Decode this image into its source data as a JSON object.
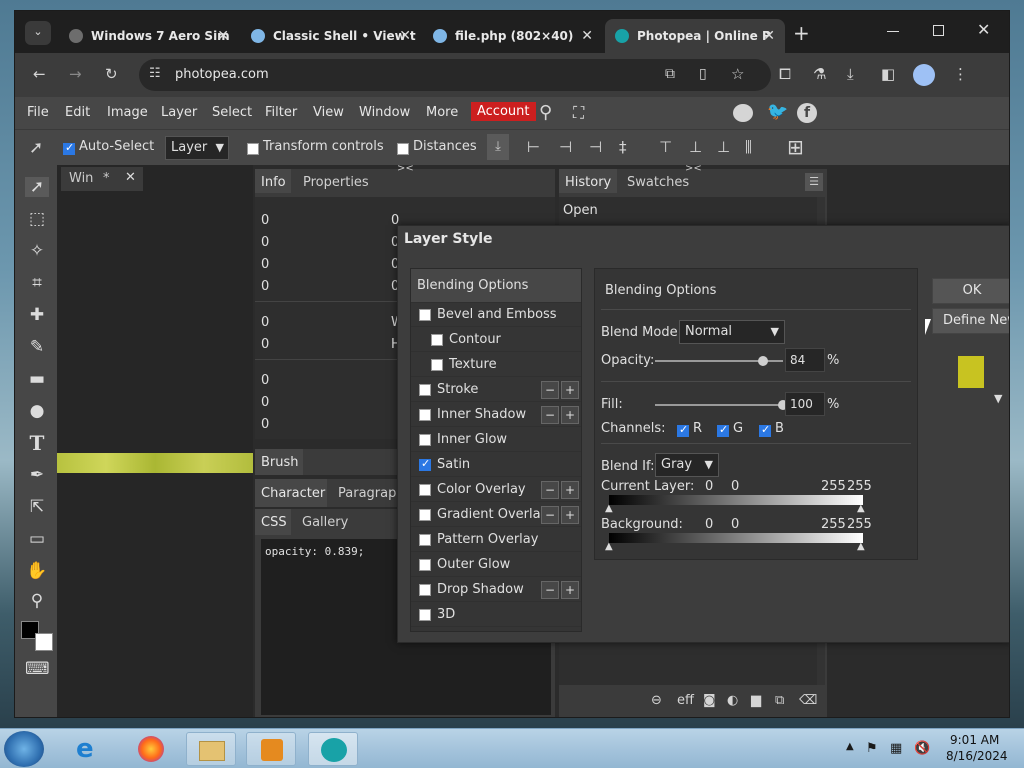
{
  "browser": {
    "tabs": [
      {
        "title": "Windows 7 Aero Sim",
        "color": "#6d6d6d"
      },
      {
        "title": "Classic Shell • View t",
        "color": "#7fb6e6"
      },
      {
        "title": "file.php (802×40)",
        "color": "#7fb6e6"
      },
      {
        "title": "Photopea | Online P",
        "color": "#18a2a7"
      }
    ],
    "new_tab": "+",
    "close": "✕",
    "address": "photopea.com"
  },
  "menu": {
    "items": [
      "File",
      "Edit",
      "Image",
      "Layer",
      "Select",
      "Filter",
      "View",
      "Window",
      "More"
    ],
    "account": "Account"
  },
  "toolbar": {
    "auto_select": "Auto-Select",
    "layer_select": "Layer",
    "transform_controls": "Transform controls",
    "distances": "Distances"
  },
  "doc_tab": {
    "name": "Win",
    "marker": "*",
    "close": "✕"
  },
  "info_panel": {
    "tabs": [
      "Info",
      "Properties"
    ],
    "rows_left": [
      "0",
      "0",
      "0",
      "0",
      "0",
      "0",
      "0",
      "0",
      "0"
    ],
    "rows_right": [
      "0",
      "0",
      "0",
      "0",
      "W",
      "H"
    ]
  },
  "history_panel": {
    "tabs": [
      "History",
      "Swatches"
    ],
    "items": [
      "Open"
    ]
  },
  "brush_panel": {
    "label": "Brush"
  },
  "char_panel": {
    "tabs": [
      "Character",
      "Paragraph"
    ]
  },
  "css_panel": {
    "tabs": [
      "CSS",
      "Gallery"
    ],
    "code": "opacity: 0.839;"
  },
  "dialog": {
    "title": "Layer Style",
    "left_header": "Blending Options",
    "styles": [
      {
        "label": "Bevel and Emboss",
        "checked": false,
        "indent": false,
        "buttons": false
      },
      {
        "label": "Contour",
        "checked": false,
        "indent": true,
        "buttons": false
      },
      {
        "label": "Texture",
        "checked": false,
        "indent": true,
        "buttons": false
      },
      {
        "label": "Stroke",
        "checked": false,
        "indent": false,
        "buttons": true
      },
      {
        "label": "Inner Shadow",
        "checked": false,
        "indent": false,
        "buttons": true
      },
      {
        "label": "Inner Glow",
        "checked": false,
        "indent": false,
        "buttons": false
      },
      {
        "label": "Satin",
        "checked": true,
        "indent": false,
        "buttons": false
      },
      {
        "label": "Color Overlay",
        "checked": false,
        "indent": false,
        "buttons": true
      },
      {
        "label": "Gradient Overlay",
        "checked": false,
        "indent": false,
        "buttons": true
      },
      {
        "label": "Pattern Overlay",
        "checked": false,
        "indent": false,
        "buttons": false
      },
      {
        "label": "Outer Glow",
        "checked": false,
        "indent": false,
        "buttons": false
      },
      {
        "label": "Drop Shadow",
        "checked": false,
        "indent": false,
        "buttons": true
      },
      {
        "label": "3D",
        "checked": false,
        "indent": false,
        "buttons": false
      }
    ],
    "minus": "−",
    "plus": "+",
    "right_header": "Blending Options",
    "blend_mode_label": "Blend Mode:",
    "blend_mode": "Normal",
    "opacity_label": "Opacity:",
    "opacity": "84",
    "opacity_level": 0.84,
    "percent": "%",
    "fill_label": "Fill:",
    "fill": "100",
    "fill_level": 1.0,
    "channels_label": "Channels:",
    "channels": [
      "R",
      "G",
      "B"
    ],
    "blend_if_label": "Blend If:",
    "blend_if": "Gray",
    "current_layer_label": "Current Layer:",
    "current_layer_values": [
      "0",
      "0",
      "255",
      "255"
    ],
    "background_label": "Background:",
    "background_values": [
      "0",
      "0",
      "255",
      "255"
    ],
    "ok": "OK",
    "define_new": "Define New",
    "preview_color": "#c8c321"
  },
  "taskbar": {
    "time": "9:01 AM",
    "date": "8/16/2024"
  }
}
